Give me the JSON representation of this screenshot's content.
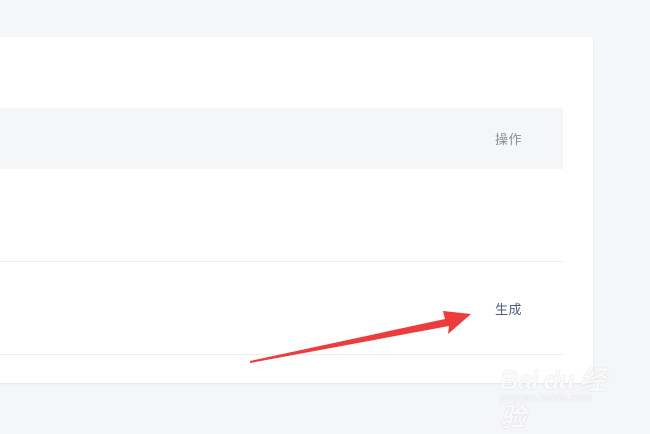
{
  "table": {
    "header": {
      "actions_label": "操作"
    },
    "rows": [
      {
        "action_label": ""
      },
      {
        "action_label": "生成"
      }
    ]
  },
  "annotation": {
    "arrow_color": "#ee3b3b"
  },
  "watermark": {
    "logo_text": "Bai du 经验",
    "url": "jingyan.baidu.com"
  }
}
